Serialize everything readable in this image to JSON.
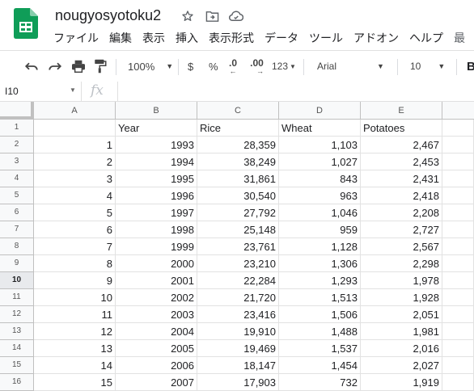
{
  "app": {
    "doc_title": "nougyosyotoku2",
    "menu": [
      "ファイル",
      "編集",
      "表示",
      "挿入",
      "表示形式",
      "データ",
      "ツール",
      "アドオン",
      "ヘルプ",
      "最"
    ]
  },
  "toolbar": {
    "zoom": "100%",
    "currency": "$",
    "percent": "%",
    "decrease_decimal": ".0",
    "increase_decimal": ".00",
    "more_formats": "123",
    "font": "Arial",
    "font_size": "10",
    "bold": "B"
  },
  "formula_bar": {
    "cell_ref": "I10",
    "fx_label": "fx",
    "value": ""
  },
  "sheet": {
    "columns": [
      "A",
      "B",
      "C",
      "D",
      "E"
    ],
    "row_numbers": [
      "1",
      "2",
      "3",
      "4",
      "5",
      "6",
      "7",
      "8",
      "9",
      "10",
      "11",
      "12",
      "13",
      "14",
      "15",
      "16"
    ],
    "selected_row": "10",
    "header_row": [
      "",
      "Year",
      "Rice",
      "Wheat",
      "Potatoes"
    ],
    "rows": [
      [
        "1",
        "1993",
        "28,359",
        "1,103",
        "2,467"
      ],
      [
        "2",
        "1994",
        "38,249",
        "1,027",
        "2,453"
      ],
      [
        "3",
        "1995",
        "31,861",
        "843",
        "2,431"
      ],
      [
        "4",
        "1996",
        "30,540",
        "963",
        "2,418"
      ],
      [
        "5",
        "1997",
        "27,792",
        "1,046",
        "2,208"
      ],
      [
        "6",
        "1998",
        "25,148",
        "959",
        "2,727"
      ],
      [
        "7",
        "1999",
        "23,761",
        "1,128",
        "2,567"
      ],
      [
        "8",
        "2000",
        "23,210",
        "1,306",
        "2,298"
      ],
      [
        "9",
        "2001",
        "22,284",
        "1,293",
        "1,978"
      ],
      [
        "10",
        "2002",
        "21,720",
        "1,513",
        "1,928"
      ],
      [
        "11",
        "2003",
        "23,416",
        "1,506",
        "2,051"
      ],
      [
        "12",
        "2004",
        "19,910",
        "1,488",
        "1,981"
      ],
      [
        "13",
        "2005",
        "19,469",
        "1,537",
        "2,016"
      ],
      [
        "14",
        "2006",
        "18,147",
        "1,454",
        "2,027"
      ],
      [
        "15",
        "2007",
        "17,903",
        "732",
        "1,919"
      ]
    ]
  },
  "colors": {
    "logo_green": "#0F9D58",
    "header_bg": "#f8f9fa",
    "grid_line": "#e2e2e2"
  }
}
